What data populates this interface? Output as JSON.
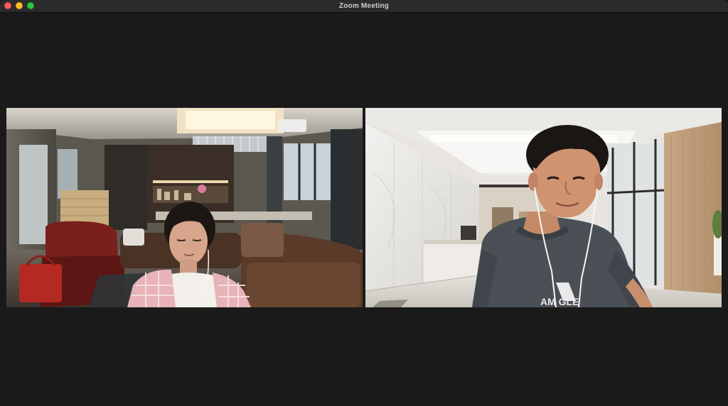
{
  "window": {
    "title": "Zoom Meeting"
  },
  "participants": [
    {
      "shirt_text": ""
    },
    {
      "shirt_text": "AM    GLE"
    }
  ]
}
